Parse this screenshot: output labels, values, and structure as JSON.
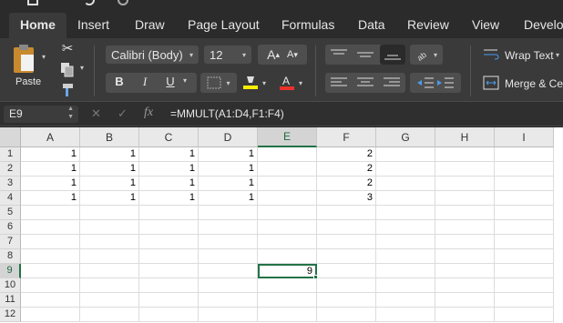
{
  "ribbon_tabs": [
    "Home",
    "Insert",
    "Draw",
    "Page Layout",
    "Formulas",
    "Data",
    "Review",
    "View",
    "Develo"
  ],
  "ribbon": {
    "paste_label": "Paste",
    "font_name": "Calibri (Body)",
    "font_size": "12",
    "bold": "B",
    "italic": "I",
    "underline": "U",
    "grow_font": "A",
    "shrink_font": "A",
    "wrap_text": "Wrap Text",
    "merge_center": "Merge & Cen",
    "highlight_color": "#ffee00",
    "font_color": "#e8322b"
  },
  "formula_bar": {
    "name_box": "E9",
    "fx": "fx",
    "formula": "=MMULT(A1:D4,F1:F4)"
  },
  "columns": [
    "A",
    "B",
    "C",
    "D",
    "E",
    "F",
    "G",
    "H",
    "I"
  ],
  "rows": [
    "1",
    "2",
    "3",
    "4",
    "5",
    "6",
    "7",
    "8",
    "9",
    "10",
    "11",
    "12"
  ],
  "selected_cell": "E9",
  "accent_color": "#217346",
  "cells": [
    {
      "ref": "A1",
      "value": "1"
    },
    {
      "ref": "B1",
      "value": "1"
    },
    {
      "ref": "C1",
      "value": "1"
    },
    {
      "ref": "D1",
      "value": "1"
    },
    {
      "ref": "F1",
      "value": "2"
    },
    {
      "ref": "A2",
      "value": "1"
    },
    {
      "ref": "B2",
      "value": "1"
    },
    {
      "ref": "C2",
      "value": "1"
    },
    {
      "ref": "D2",
      "value": "1"
    },
    {
      "ref": "F2",
      "value": "2"
    },
    {
      "ref": "A3",
      "value": "1"
    },
    {
      "ref": "B3",
      "value": "1"
    },
    {
      "ref": "C3",
      "value": "1"
    },
    {
      "ref": "D3",
      "value": "1"
    },
    {
      "ref": "F3",
      "value": "2"
    },
    {
      "ref": "A4",
      "value": "1"
    },
    {
      "ref": "B4",
      "value": "1"
    },
    {
      "ref": "C4",
      "value": "1"
    },
    {
      "ref": "D4",
      "value": "1"
    },
    {
      "ref": "F4",
      "value": "3"
    },
    {
      "ref": "E9",
      "value": "9"
    }
  ]
}
